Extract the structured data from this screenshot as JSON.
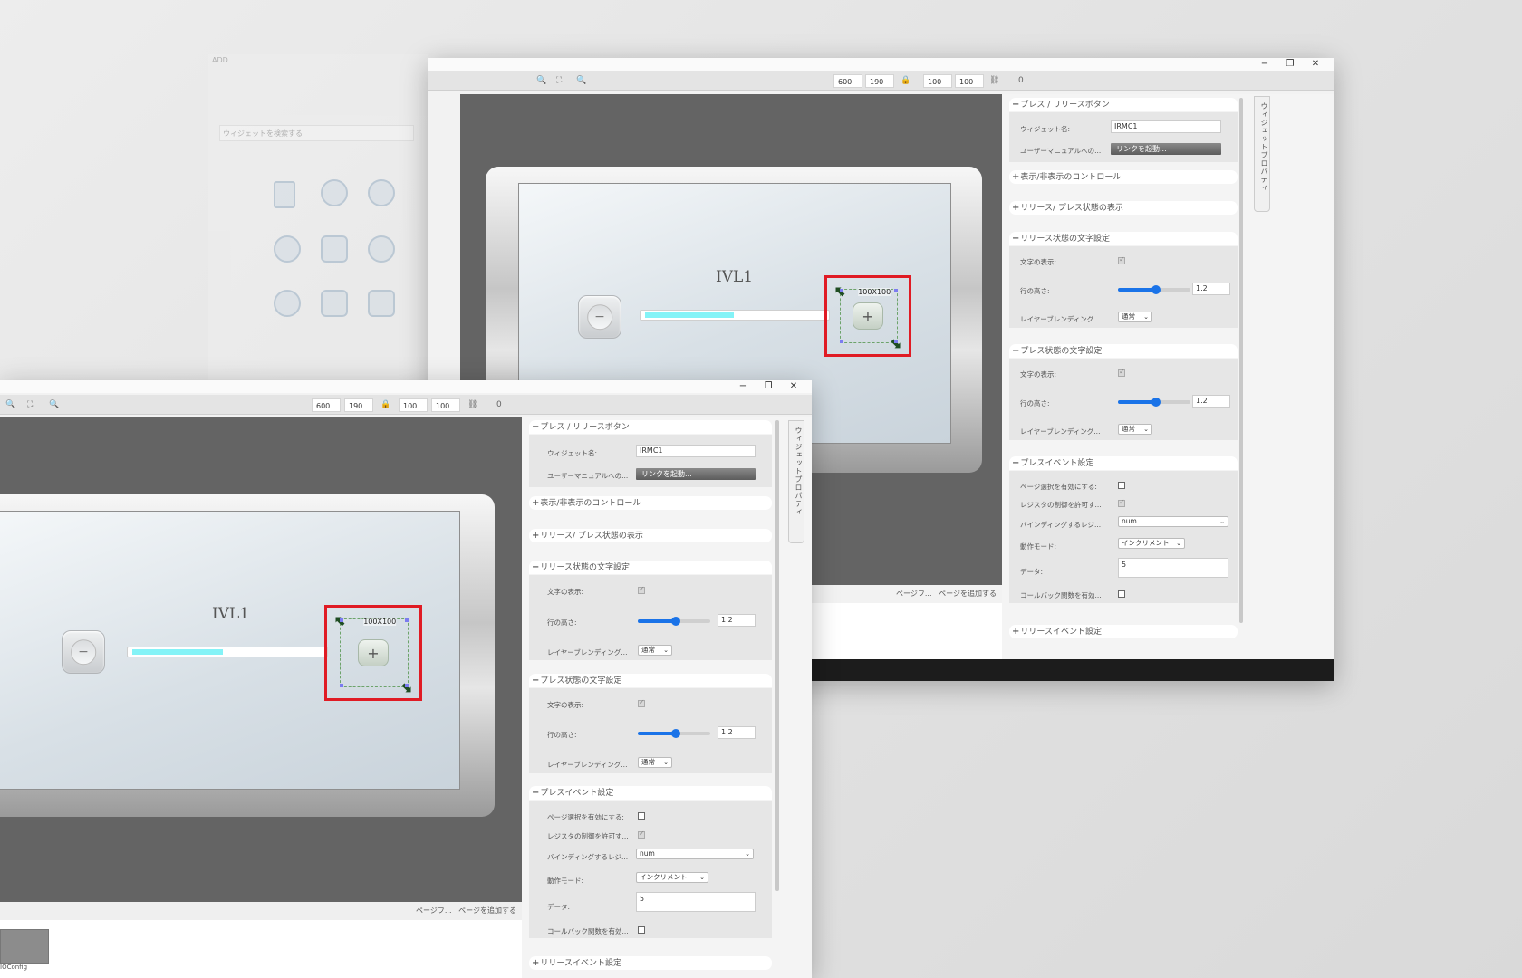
{
  "tb": {
    "w": "600",
    "h": "190",
    "x": "100",
    "y": "100",
    "angle": "0"
  },
  "win": {
    "min": "−",
    "max": "❐",
    "close": "✕"
  },
  "widget": {
    "ivl_label": "IVL1",
    "size_label": "100X100",
    "minus": "−",
    "plus": "+"
  },
  "panel_tab": "ウィジェットプロパティ",
  "sections": {
    "press_release": "プレス / リリースボタン",
    "visibility": "表示/非表示のコントロール",
    "release_press_display": "リリース/ プレス状態の表示",
    "release_text": "リリース状態の文字設定",
    "press_text": "プレス状態の文字設定",
    "press_event": "プレスイベント設定",
    "release_event": "リリースイベント設定"
  },
  "fields": {
    "widget_name_label": "ウィジェット名:",
    "widget_name": "IRMC1",
    "manual_label": "ユーザーマニュアルへの...",
    "manual_btn": "リンクを起動...",
    "show_text": "文字の表示:",
    "line_height": "行の高さ:",
    "line_height_value": "1.2",
    "blend": "レイヤーブレンディング...",
    "blend_value": "通常",
    "page_select": "ページ選択を有効にする:",
    "register_control": "レジスタの制御を許可す...",
    "binding_register": "バインディングするレジ...",
    "binding_value": "num",
    "action_mode": "動作モード:",
    "action_value": "インクリメント",
    "data": "データ:",
    "data_value": "5",
    "callback": "コールバック関数を有効..."
  },
  "canvas_bar": {
    "page_f": "ページフ...",
    "add_page": "ページを追加する"
  },
  "thumb_label": "IOConfig",
  "ghost": {
    "search_placeholder": "ウィジェットを検索する",
    "brand": "ADD"
  },
  "colors": {
    "accent": "#1a73e8",
    "selection": "#e01b24",
    "fill": "#84f3f7",
    "canvas": "#646464"
  }
}
